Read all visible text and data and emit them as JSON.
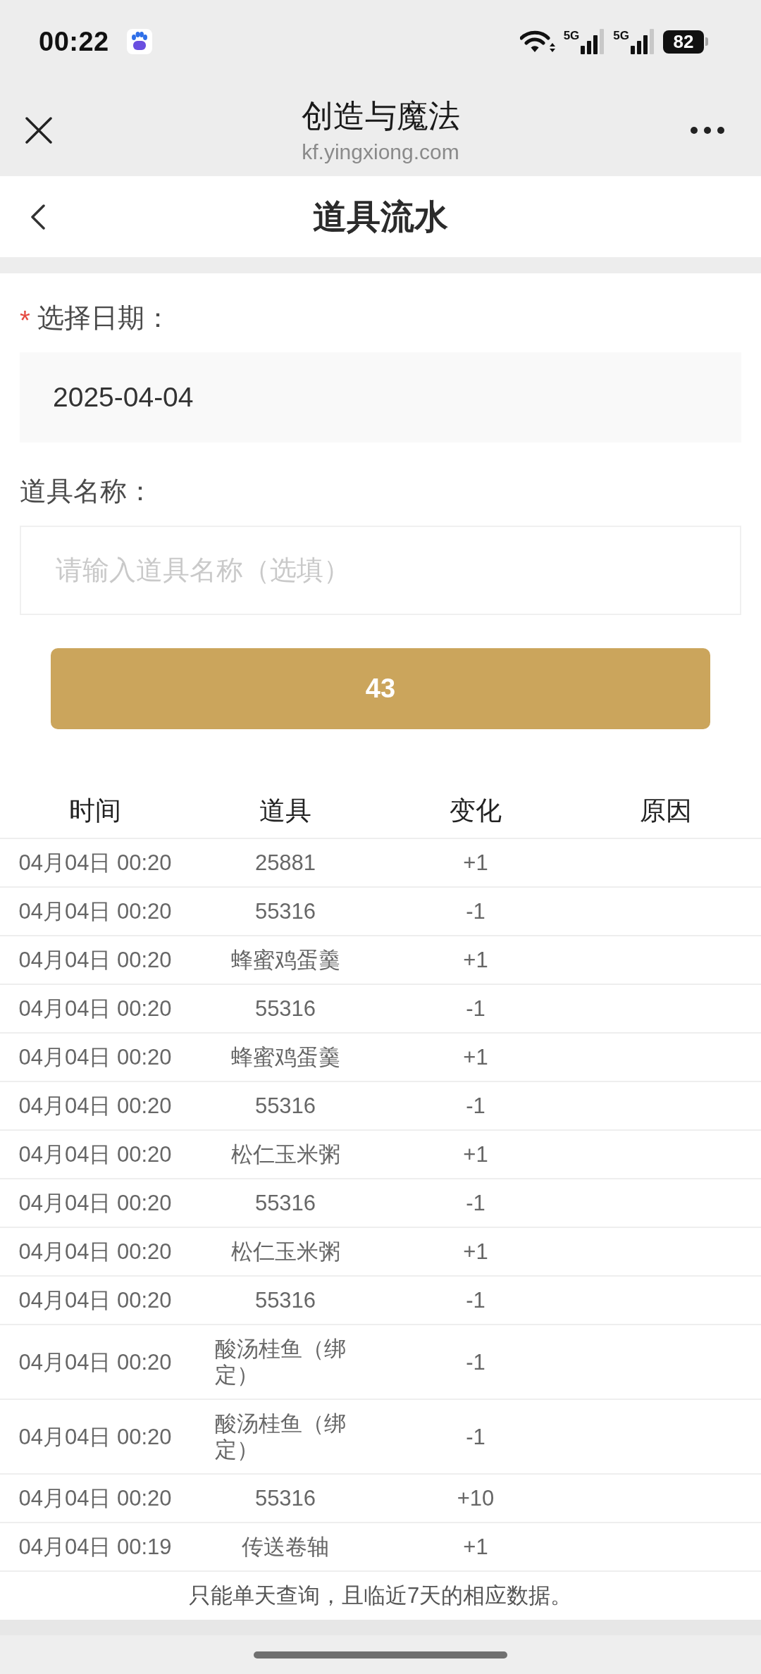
{
  "status_bar": {
    "time": "00:22",
    "signals": [
      {
        "network": "5G"
      },
      {
        "network": "5G"
      }
    ],
    "battery": "82"
  },
  "browser_bar": {
    "title": "创造与魔法",
    "url": "kf.yingxiong.com"
  },
  "page_header": {
    "title": "道具流水"
  },
  "form": {
    "fields": [
      {
        "kind": "date",
        "required_mark": "*",
        "label": "选择日期：",
        "value": "2025-04-04"
      },
      {
        "kind": "text",
        "label": "道具名称：",
        "placeholder": "请输入道具名称（选填）"
      }
    ],
    "submit_button": {
      "label": "43"
    }
  },
  "table": {
    "columns": [
      "时间",
      "道具",
      "变化",
      "原因"
    ],
    "rows": [
      {
        "time": "04月04日 00:20",
        "item": "25881",
        "change": "+1"
      },
      {
        "time": "04月04日 00:20",
        "item": "55316",
        "change": "-1"
      },
      {
        "time": "04月04日 00:20",
        "item": "蜂蜜鸡蛋羹",
        "change": "+1"
      },
      {
        "time": "04月04日 00:20",
        "item": "55316",
        "change": "-1"
      },
      {
        "time": "04月04日 00:20",
        "item": "蜂蜜鸡蛋羹",
        "change": "+1"
      },
      {
        "time": "04月04日 00:20",
        "item": "55316",
        "change": "-1"
      },
      {
        "time": "04月04日 00:20",
        "item": "松仁玉米粥",
        "change": "+1"
      },
      {
        "time": "04月04日 00:20",
        "item": "55316",
        "change": "-1"
      },
      {
        "time": "04月04日 00:20",
        "item": "松仁玉米粥",
        "change": "+1"
      },
      {
        "time": "04月04日 00:20",
        "item": "55316",
        "change": "-1"
      },
      {
        "time": "04月04日 00:20",
        "item": "酸汤桂鱼（绑定）",
        "change": "-1"
      },
      {
        "time": "04月04日 00:20",
        "item": "酸汤桂鱼（绑定）",
        "change": "-1"
      },
      {
        "time": "04月04日 00:20",
        "item": "55316",
        "change": "+10"
      },
      {
        "time": "04月04日 00:19",
        "item": "传送卷轴",
        "change": "+1"
      }
    ]
  },
  "footer_note": "只能单天查询，且临近7天的相应数据。"
}
